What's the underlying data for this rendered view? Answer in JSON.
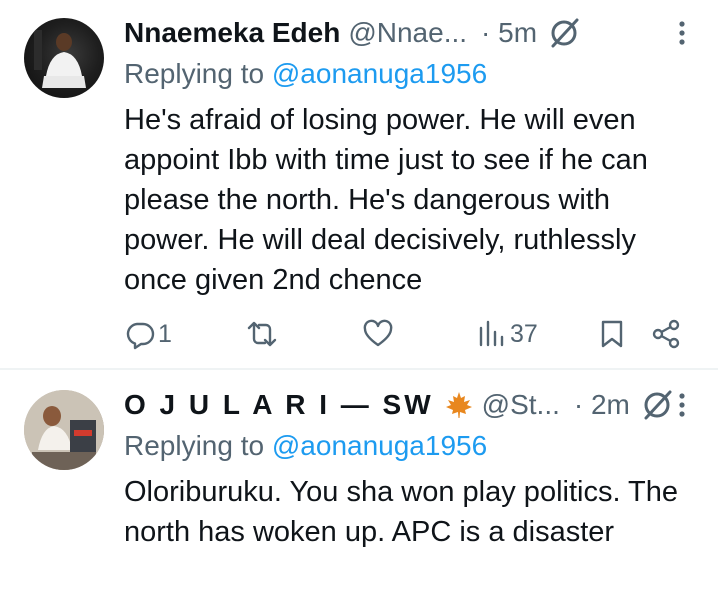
{
  "tweets": [
    {
      "display_name": "Nnaemeka Edeh",
      "handle": "@Nnae...",
      "time": "· 5m",
      "replying_prefix": "Replying to ",
      "replying_to": "@aonanuga1956",
      "text": "He's afraid of losing power. He will even appoint Ibb with time just to see if he can please the north. He's dangerous with power. He will deal decisively, ruthlessly once given 2nd chence",
      "replies": "1",
      "views": "37"
    },
    {
      "display_name": "O J U L A R I — SW",
      "handle": "@St...",
      "time": "· 2m",
      "replying_prefix": "Replying to ",
      "replying_to": "@aonanuga1956",
      "text": "Oloriburuku. You sha won play politics. The north has woken up. APC is a disaster"
    }
  ],
  "icons": {
    "grok": "grok-slash-circle-icon",
    "more": "more-vertical-icon",
    "maple": "maple-leaf-icon",
    "reply": "reply-bubble-icon",
    "retweet": "retweet-icon",
    "like": "heart-icon",
    "views": "views-bar-icon",
    "bookmark": "bookmark-icon",
    "share": "share-icon"
  },
  "colors": {
    "text": "#0f1419",
    "secondary": "#536471",
    "link": "#1d9bf0",
    "divider": "#eff3f4",
    "maple": "#e8871e"
  }
}
